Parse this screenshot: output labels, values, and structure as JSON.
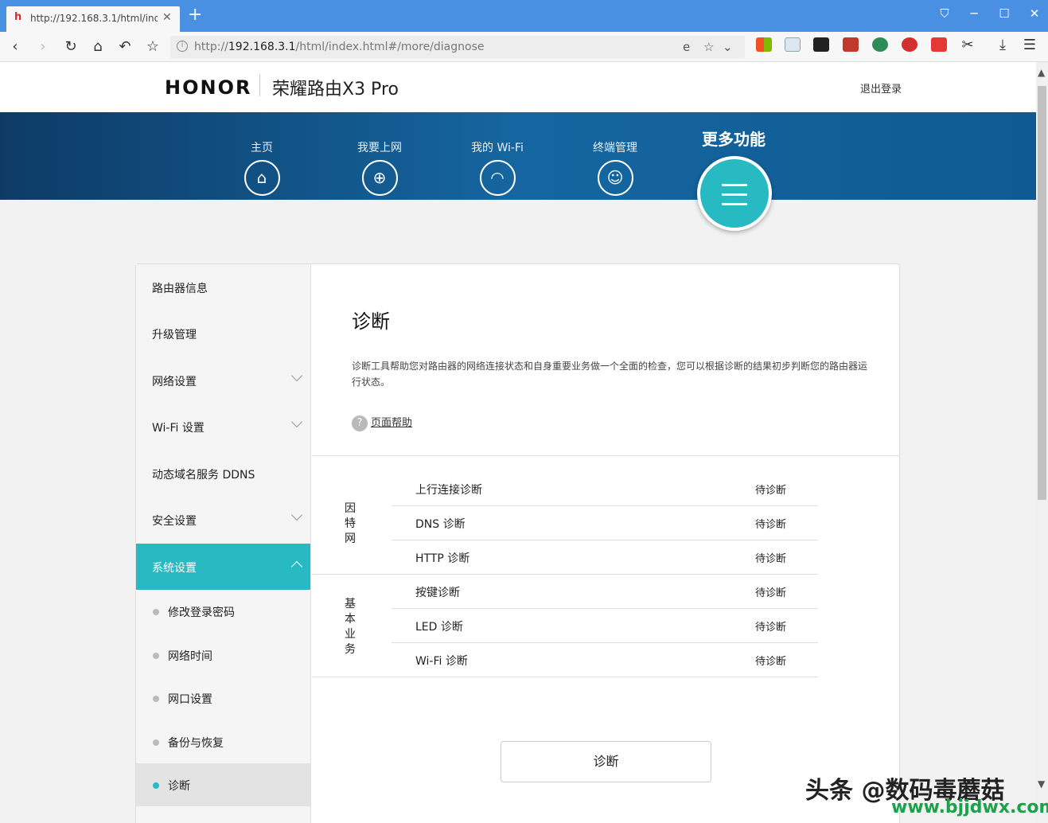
{
  "browser": {
    "tab_title": "http://192.168.3.1/html/ind",
    "url_prefix": "http://",
    "url_host": "192.168.3.1",
    "url_path": "/html/index.html#/more/diagnose"
  },
  "header": {
    "logo": "HONOR",
    "product": "荣耀路由X3 Pro",
    "logout": "退出登录"
  },
  "nav": {
    "items": [
      {
        "label": "主页",
        "icon": "home-icon"
      },
      {
        "label": "我要上网",
        "icon": "globe-icon"
      },
      {
        "label": "我的 Wi-Fi",
        "icon": "wifi-icon"
      },
      {
        "label": "终端管理",
        "icon": "user-icon"
      }
    ],
    "active_label": "更多功能",
    "accent": "#27bac2"
  },
  "sidebar": {
    "items": [
      {
        "label": "路由器信息"
      },
      {
        "label": "升级管理"
      },
      {
        "label": "网络设置"
      },
      {
        "label": "Wi-Fi 设置"
      },
      {
        "label": "动态域名服务 DDNS"
      },
      {
        "label": "安全设置"
      },
      {
        "label": "系统设置"
      }
    ],
    "sub_items": [
      {
        "label": "修改登录密码"
      },
      {
        "label": "网络时间"
      },
      {
        "label": "网口设置"
      },
      {
        "label": "备份与恢复"
      },
      {
        "label": "诊断"
      }
    ]
  },
  "main": {
    "title": "诊断",
    "description": "诊断工具帮助您对路由器的网络连接状态和自身重要业务做一个全面的检查，您可以根据诊断的结果初步判断您的路由器运行状态。",
    "help_link": "页面帮助",
    "groups": [
      {
        "label": "因\n特\n网",
        "rows": [
          {
            "name": "上行连接诊断",
            "status": "待诊断"
          },
          {
            "name": "DNS 诊断",
            "status": "待诊断"
          },
          {
            "name": "HTTP 诊断",
            "status": "待诊断"
          }
        ]
      },
      {
        "label": "基\n本\n业\n务",
        "rows": [
          {
            "name": "按键诊断",
            "status": "待诊断"
          },
          {
            "name": "LED 诊断",
            "status": "待诊断"
          },
          {
            "name": "Wi-Fi 诊断",
            "status": "待诊断"
          }
        ]
      }
    ],
    "diagnose_button": "诊断"
  },
  "watermark": {
    "line1": "头条 @数码毒蘑菇",
    "line2": "www.bjjdwx.com"
  }
}
